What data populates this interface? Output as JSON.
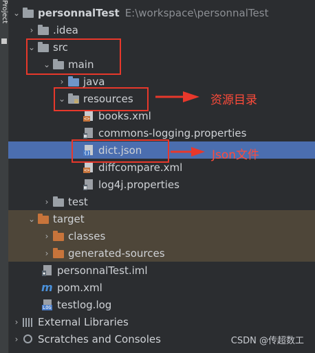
{
  "gutter_label": "Project",
  "root": {
    "name": "personnalTest",
    "path": "E:\\workspace\\personnalTest"
  },
  "items": {
    "idea": ".idea",
    "src": "src",
    "main": "main",
    "java": "java",
    "resources": "resources",
    "books": "books.xml",
    "commons": "commons-logging.properties",
    "dict": "dict.json",
    "diffcompare": "diffcompare.xml",
    "log4j": "log4j.properties",
    "test": "test",
    "target": "target",
    "classes": "classes",
    "generated": "generated-sources",
    "iml": "personnalTest.iml",
    "pom": "pom.xml",
    "testlog": "testlog.log",
    "external": "External Libraries",
    "scratches": "Scratches and Consoles"
  },
  "annotations": {
    "resources_note": "资源目录",
    "json_note": "Json文件"
  },
  "watermark": "CSDN @传超数工",
  "colors": {
    "highlight": "#e8382b",
    "selection": "#4b6eaf",
    "excluded": "#4e4639"
  }
}
